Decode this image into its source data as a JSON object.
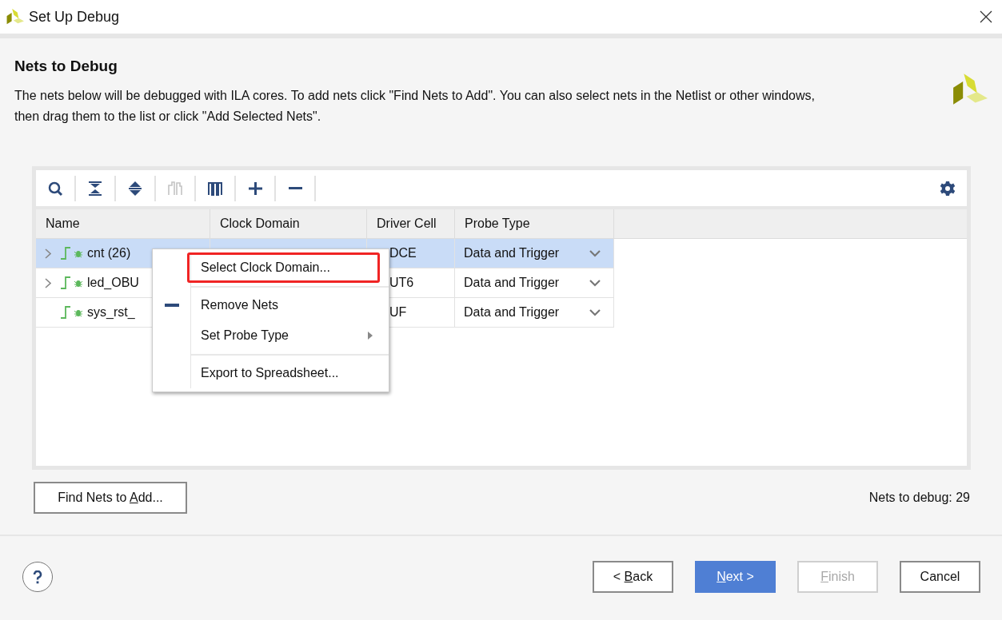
{
  "window": {
    "title": "Set Up Debug"
  },
  "page": {
    "heading": "Nets to Debug",
    "description": "The nets below will be debugged with ILA cores. To add nets click \"Find Nets to Add\". You can also select nets in the Netlist or other windows,\nthen drag them to the list or click \"Add Selected Nets\"."
  },
  "toolbar": {
    "tools": [
      {
        "kind": "search",
        "disabled": false
      },
      {
        "kind": "collapse",
        "disabled": false
      },
      {
        "kind": "expand",
        "disabled": false
      },
      {
        "kind": "wave",
        "disabled": true
      },
      {
        "kind": "pulse",
        "disabled": false
      },
      {
        "kind": "add",
        "disabled": false
      },
      {
        "kind": "remove",
        "disabled": false
      }
    ]
  },
  "table": {
    "columns": [
      "Name",
      "Clock Domain",
      "Driver Cell",
      "Probe Type"
    ],
    "rows": [
      {
        "name": "cnt (26)",
        "expandable": true,
        "selected": true,
        "driver_cell": "DCE",
        "probe_type": "Data and Trigger"
      },
      {
        "name": "led_OBU",
        "expandable": true,
        "selected": false,
        "driver_cell": "UT6",
        "probe_type": "Data and Trigger"
      },
      {
        "name": "sys_rst_",
        "expandable": false,
        "selected": false,
        "driver_cell": "UF",
        "probe_type": "Data and Trigger"
      }
    ]
  },
  "context_menu": {
    "items": [
      {
        "kind": "item",
        "label": "Select Clock Domain...",
        "highlighted": true,
        "has_icon": false
      },
      {
        "kind": "separator"
      },
      {
        "kind": "item",
        "label": "Remove Nets",
        "highlighted": false,
        "has_icon": true
      },
      {
        "kind": "submenu",
        "label": "Set Probe Type",
        "highlighted": false,
        "has_icon": false
      },
      {
        "kind": "separator"
      },
      {
        "kind": "item",
        "label": "Export to Spreadsheet...",
        "highlighted": false,
        "has_icon": false
      }
    ]
  },
  "find_button": {
    "label": {
      "pre": "Find Nets to ",
      "key": "A",
      "post": "dd..."
    }
  },
  "status": "Nets to debug: 29",
  "buttons": [
    {
      "label": {
        "pre": "< ",
        "key": "B",
        "post": "ack"
      },
      "kind": "default",
      "disabled": false
    },
    {
      "label": {
        "key": "N",
        "post": "ext >"
      },
      "kind": "primary",
      "disabled": false
    },
    {
      "label": {
        "key": "F",
        "post": "inish"
      },
      "kind": "default",
      "disabled": true
    },
    {
      "label": {
        "post": "Cancel"
      },
      "kind": "default",
      "disabled": false
    }
  ]
}
